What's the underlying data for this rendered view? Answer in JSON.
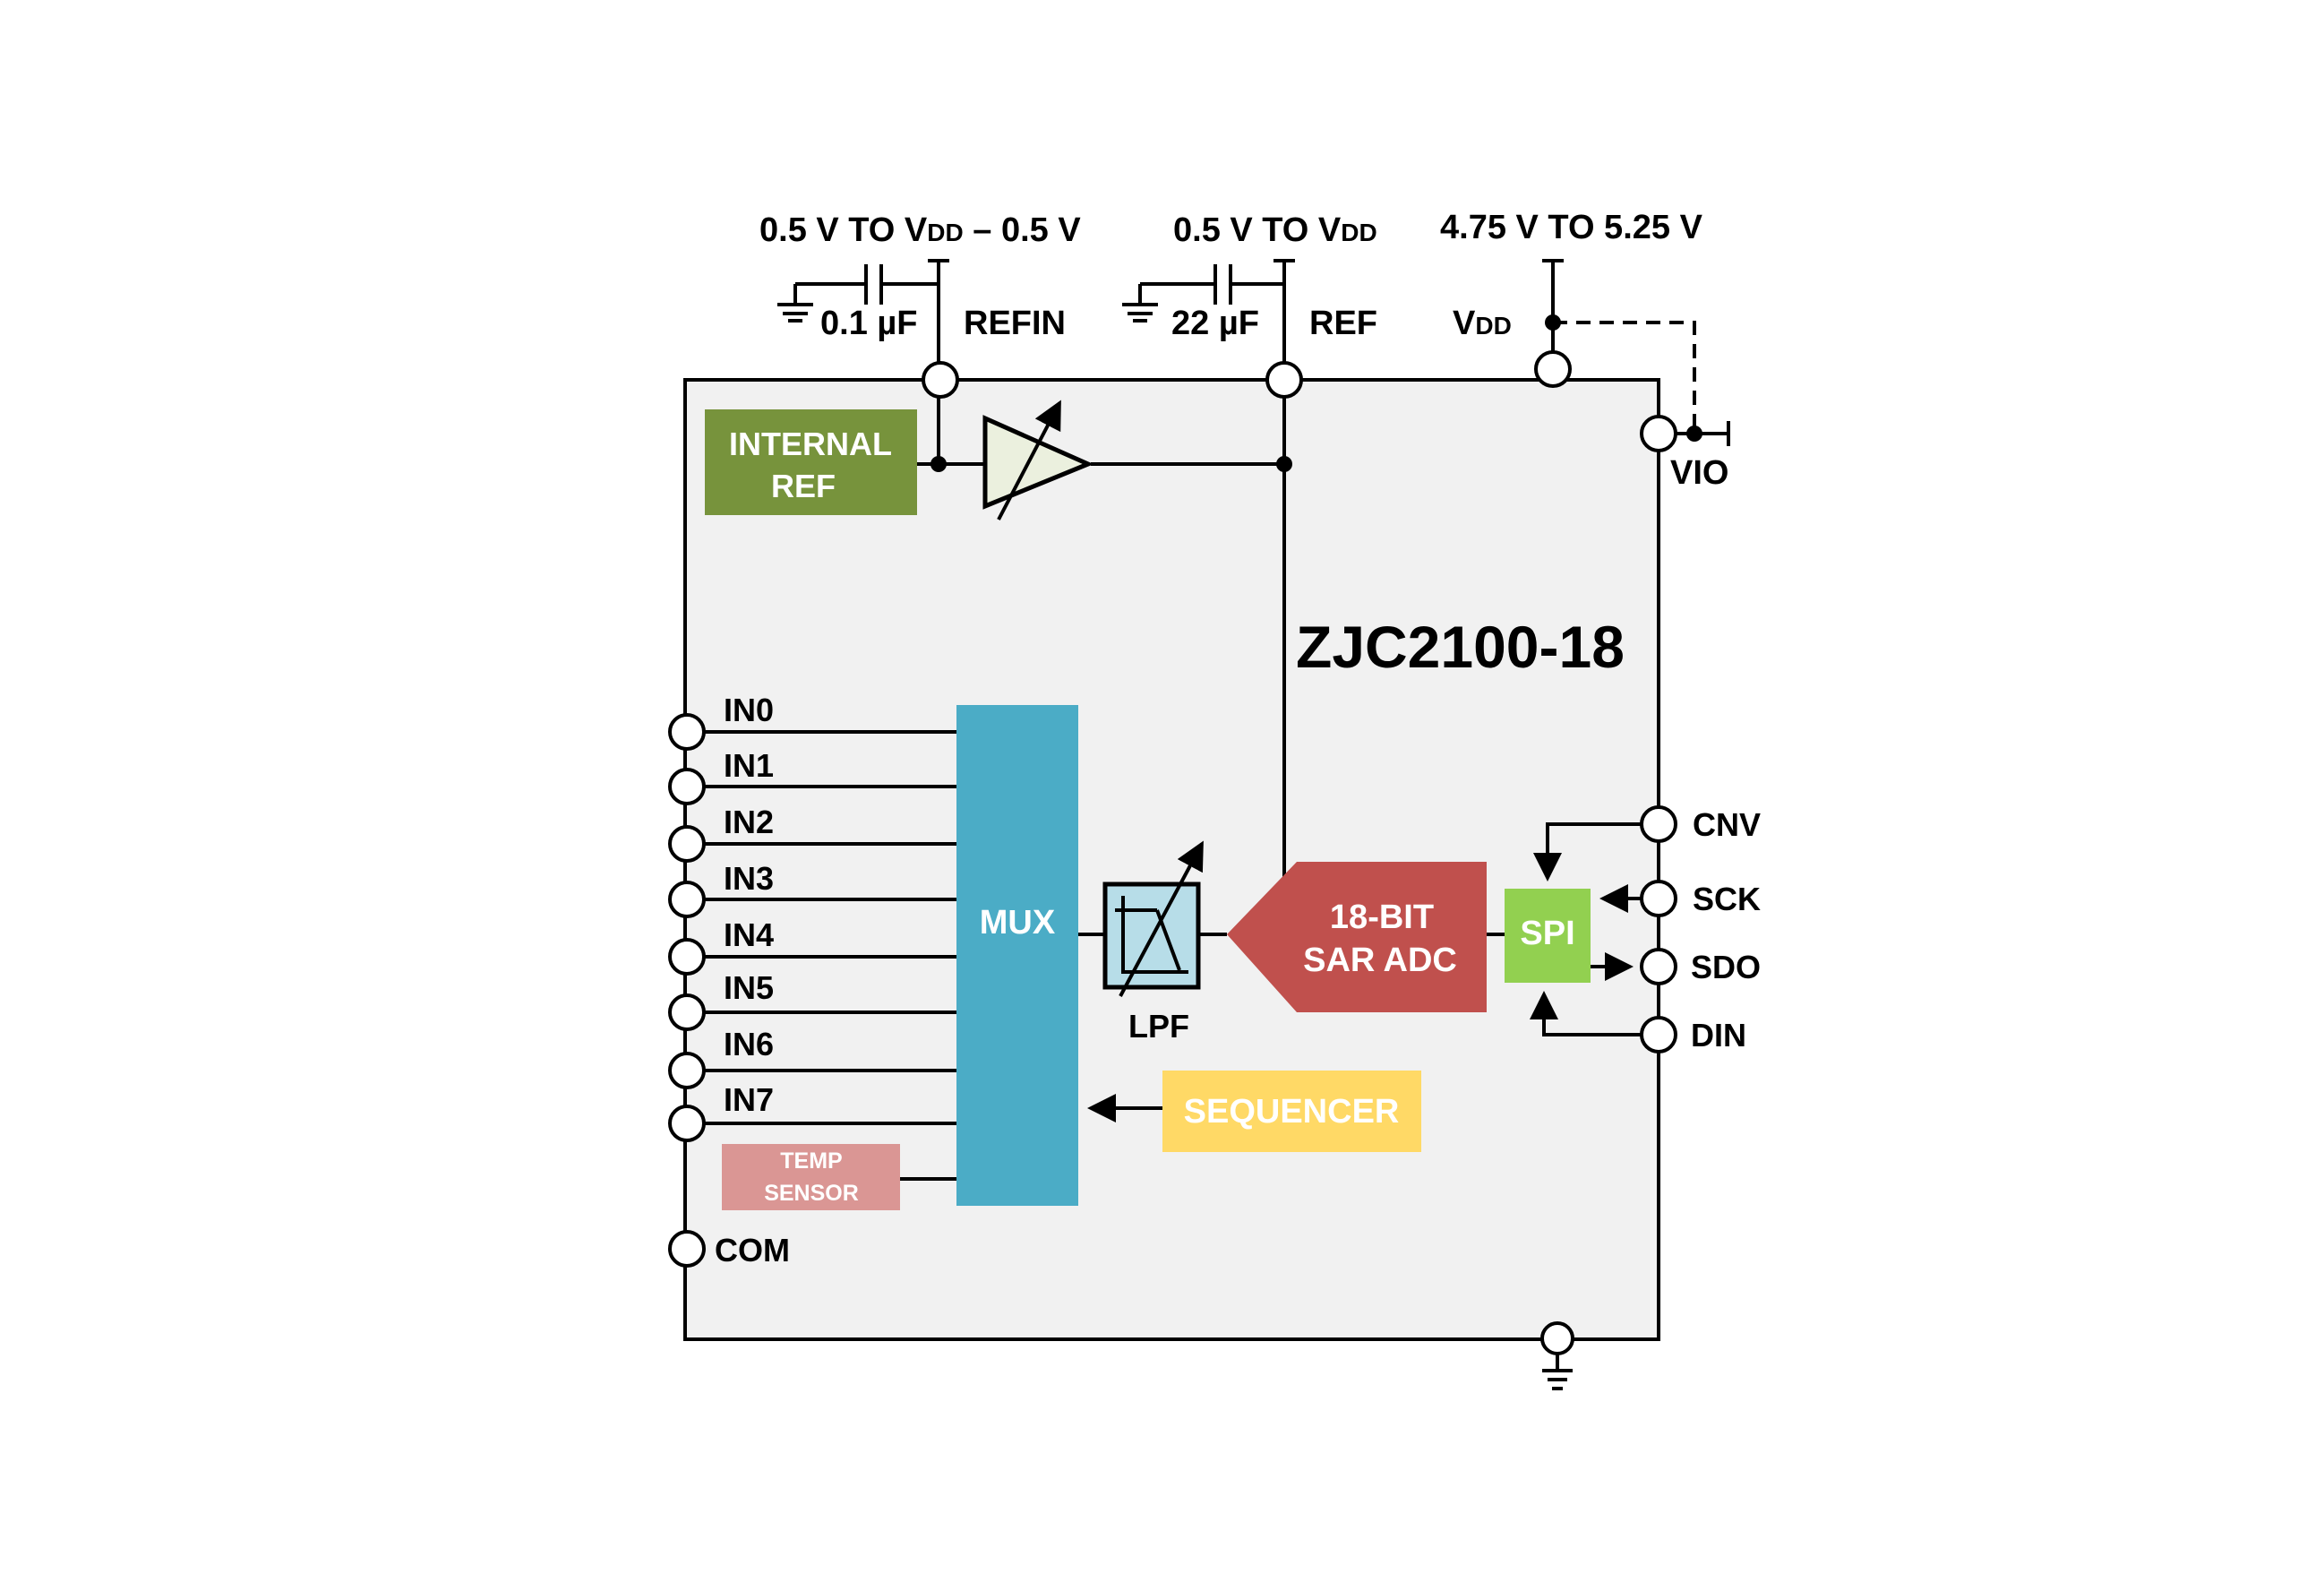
{
  "diagram": {
    "part_number": "ZJC2100-18",
    "supply_labels": {
      "refin_range": {
        "main": "0.5 V TO V",
        "sub": "DD",
        "tail": " – 0.5 V"
      },
      "ref_range": {
        "main": "0.5 V TO V",
        "sub": "DD"
      },
      "vdd_range": "4.75 V TO 5.25 V"
    },
    "capacitors": {
      "refin_cap": "0.1 µF",
      "ref_cap": "22 µF"
    },
    "pins": {
      "refin": "REFIN",
      "ref": "REF",
      "vdd": {
        "main": "V",
        "sub": "DD"
      },
      "vio": "VIO",
      "inputs": [
        "IN0",
        "IN1",
        "IN2",
        "IN3",
        "IN4",
        "IN5",
        "IN6",
        "IN7"
      ],
      "com": "COM",
      "cnv": "CNV",
      "sck": "SCK",
      "sdo": "SDO",
      "din": "DIN"
    },
    "blocks": {
      "internal_ref": [
        "INTERNAL",
        "REF"
      ],
      "mux": "MUX",
      "lpf": "LPF",
      "adc": [
        "18-BIT",
        "SAR ADC"
      ],
      "spi": "SPI",
      "sequencer": "SEQUENCER",
      "temp_sensor": [
        "TEMP",
        "SENSOR"
      ]
    },
    "colors": {
      "chip_fill": "#f1f1f1",
      "internal_ref": "#77933c",
      "amp_fill": "#ebf0de",
      "mux": "#4bacc6",
      "lpf": "#b7dde8",
      "adc": "#c0504d",
      "spi": "#92d050",
      "sequencer": "#ffd966",
      "temp_sensor": "#da9694"
    }
  }
}
